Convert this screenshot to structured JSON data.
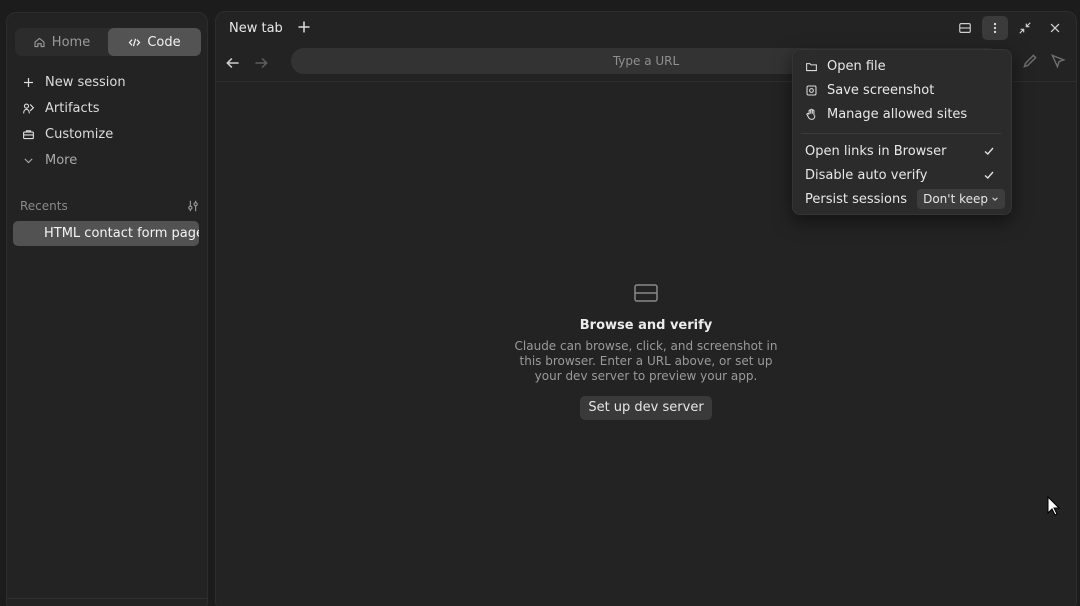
{
  "sidebar": {
    "mode_tabs": [
      {
        "label": "Home",
        "icon": "home-icon",
        "active": false
      },
      {
        "label": "Code",
        "icon": "code-icon",
        "active": true
      }
    ],
    "nav": [
      {
        "label": "New session",
        "icon": "plus-icon"
      },
      {
        "label": "Artifacts",
        "icon": "artifacts-icon"
      },
      {
        "label": "Customize",
        "icon": "briefcase-icon"
      },
      {
        "label": "More",
        "icon": "chevron-down-icon"
      }
    ],
    "recents_label": "Recents",
    "recents": [
      {
        "label": "HTML contact form page",
        "selected": true
      }
    ]
  },
  "browser": {
    "tab_title": "New tab",
    "url": {
      "value": "",
      "placeholder": "Type a URL"
    },
    "empty_state": {
      "title": "Browse and verify",
      "description": "Claude can browse, click, and screenshot in this browser. Enter a URL above, or set up your dev server to preview your app.",
      "button_label": "Set up dev server"
    }
  },
  "menu": {
    "actions": [
      {
        "label": "Open file",
        "icon": "folder-icon"
      },
      {
        "label": "Save screenshot",
        "icon": "screenshot-icon"
      },
      {
        "label": "Manage allowed sites",
        "icon": "hand-icon"
      }
    ],
    "toggles": [
      {
        "label": "Open links in Browser",
        "checked": true
      },
      {
        "label": "Disable auto verify",
        "checked": true
      }
    ],
    "persist": {
      "label": "Persist sessions",
      "value": "Don't keep"
    }
  },
  "colors": {
    "background": "#1c1c1c",
    "panel": "#232323",
    "menu": "#2b2b2b",
    "active_tab": "#535353"
  }
}
